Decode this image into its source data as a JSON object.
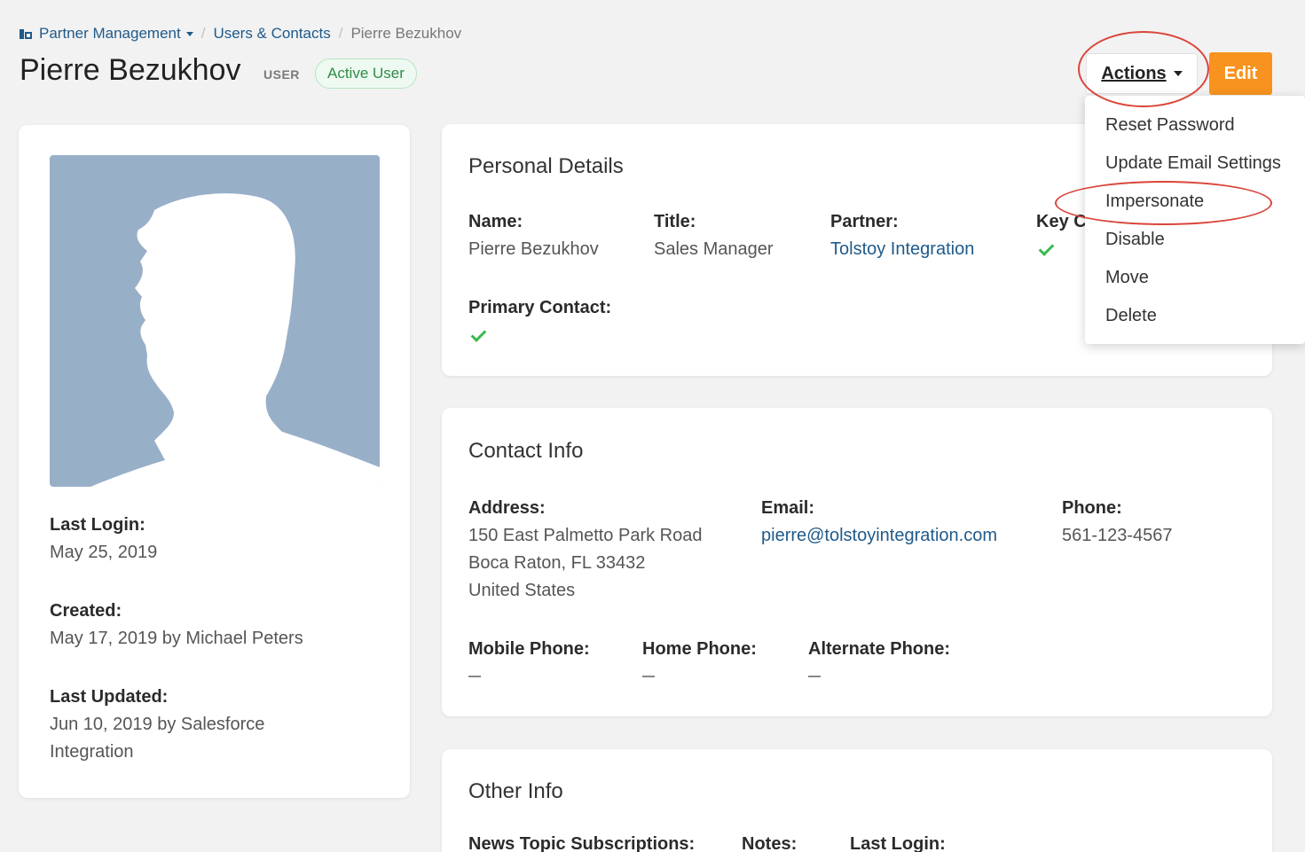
{
  "breadcrumb": {
    "root": "Partner Management",
    "section": "Users & Contacts",
    "current": "Pierre Bezukhov",
    "separator": "/"
  },
  "header": {
    "title": "Pierre Bezukhov",
    "role": "USER",
    "status": "Active User",
    "actions_label": "Actions",
    "edit_label": "Edit"
  },
  "actions_menu": {
    "items": [
      "Reset Password",
      "Update Email Settings",
      "Impersonate",
      "Disable",
      "Move",
      "Delete"
    ]
  },
  "profile": {
    "last_login_label": "Last Login:",
    "last_login": "May 25, 2019",
    "created_label": "Created:",
    "created": "May 17, 2019 by Michael Peters",
    "last_updated_label": "Last Updated:",
    "last_updated_line1": "Jun 10, 2019 by Salesforce",
    "last_updated_line2": "Integration"
  },
  "personal": {
    "title": "Personal Details",
    "name_label": "Name:",
    "name": "Pierre Bezukhov",
    "title_label": "Title:",
    "job_title": "Sales Manager",
    "partner_label": "Partner:",
    "partner": "Tolstoy Integration",
    "key_contact_label": "Key C",
    "key_contact": true,
    "primary_contact_label": "Primary Contact:",
    "primary_contact": true
  },
  "contact": {
    "title": "Contact Info",
    "address_label": "Address:",
    "address_line1": "150 East Palmetto Park Road",
    "address_line2": "Boca Raton, FL 33432",
    "address_line3": "United States",
    "email_label": "Email:",
    "email": "pierre@tolstoyintegration.com",
    "phone_label": "Phone:",
    "phone": "561-123-4567",
    "mobile_label": "Mobile Phone:",
    "home_label": "Home Phone:",
    "alternate_label": "Alternate Phone:"
  },
  "other": {
    "title": "Other Info",
    "news_label": "News Topic Subscriptions:",
    "notes_label": "Notes:",
    "last_login_label": "Last Login:"
  },
  "colors": {
    "accent": "#f7931e",
    "link": "#1f5a8a",
    "success": "#3cb94f",
    "highlight_ring": "#d9453a",
    "avatar_bg": "#98afc8"
  }
}
